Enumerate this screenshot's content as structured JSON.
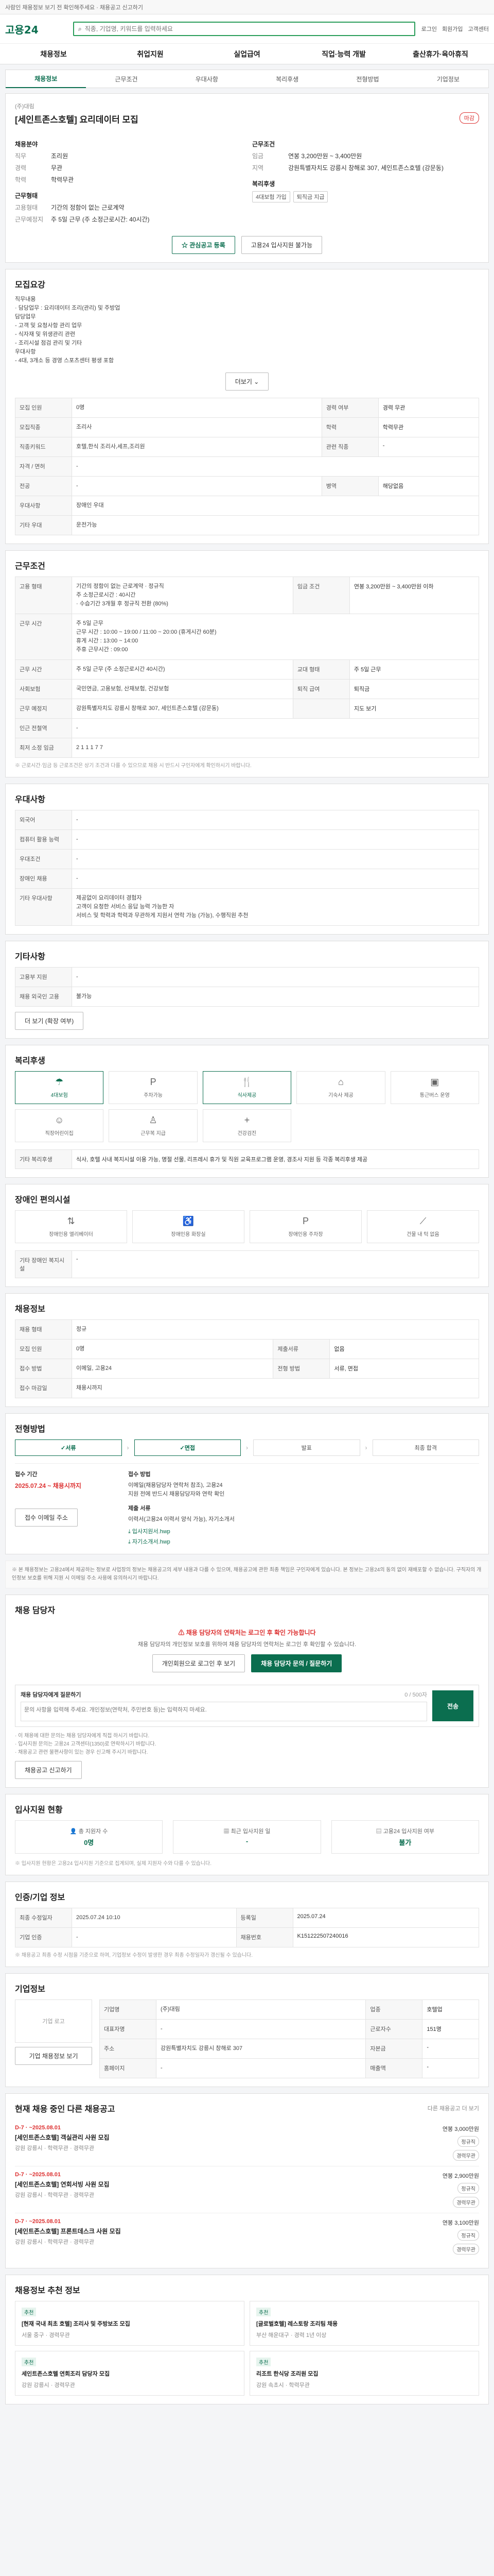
{
  "topbar": {
    "notice": "사람인 채용정보 보기 전 확인해주세요 · 채용공고 신고하기"
  },
  "header": {
    "logo": "고용24",
    "search_placeholder": "직종, 기업명, 키워드를 입력하세요",
    "links": [
      "로그인",
      "회원가입",
      "고객센터"
    ],
    "gnb": [
      "채용정보",
      "취업지원",
      "실업급여",
      "직업·능력 개발",
      "출산휴가·육아휴직"
    ]
  },
  "tabs": [
    "채용정보",
    "근무조건",
    "우대사항",
    "복리후생",
    "전형방법",
    "기업정보"
  ],
  "job": {
    "company": "(주)대림",
    "title": "[세인트존스호텔] 요리데이터 모집",
    "status": "마감",
    "left": {
      "heading": "채용분야",
      "rows": [
        {
          "k": "직무",
          "v": "조리원"
        },
        {
          "k": "경력",
          "v": "무관"
        },
        {
          "k": "학력",
          "v": "학력무관"
        }
      ],
      "cond_heading": "근무형태",
      "cond_rows": [
        {
          "k": "고용형태",
          "v": "기간의 정함이 없는 근로계약"
        },
        {
          "k": "근무예정지",
          "v": "주 5일 근무 (주 소정근로시간: 40시간)"
        }
      ]
    },
    "right": {
      "heading": "근무조건",
      "rows": [
        {
          "k": "임금",
          "v": "연봉 3,200만원 ~ 3,400만원"
        },
        {
          "k": "지역",
          "v": "강원특별자치도 강릉시 창해로 307, 세인트존스호텔 (강문동)"
        }
      ],
      "tag_heading": "복리후생",
      "chips": [
        "4대보험 가입",
        "퇴직금 지급"
      ]
    },
    "btn_interest": "관심공고 등록",
    "btn_apply": "고용24 입사지원 불가능"
  },
  "detail": {
    "heading": "모집요강",
    "body": "직무내용\n· 담당업무 : 요리데이터 조리(관리) 및 주방업\n담당업무\n  - 고객 및 요청사항 관리 업무\n  - 식자재 및 위생관리 관련\n  - 조리시설 점검 관리 및 기타\n우대사항\n  - 4대, 3개소 등 경영 스포츠센터 평생 포함",
    "more": "더보기",
    "table": [
      {
        "k": "모집 인원",
        "v": "0명",
        "k2": "경력 여부",
        "v2": "경력 무관"
      },
      {
        "k": "모집직종",
        "v": "조리사",
        "k2": "학력",
        "v2": "학력무관"
      },
      {
        "k": "직종키워드",
        "v": "호텔,한식 조리사,세프,조리원",
        "k2": "관련 직종",
        "v2": "-"
      },
      {
        "k": "자격 / 면허",
        "v": "-",
        "k2": "",
        "v2": ""
      },
      {
        "k": "전공",
        "v": "-",
        "k2": "병역",
        "v2": "해당없음"
      },
      {
        "k": "우대사항",
        "v": "장애인 우대",
        "k2": "",
        "v2": ""
      },
      {
        "k": "기타 우대",
        "v": "운전가능",
        "k2": "",
        "v2": ""
      }
    ]
  },
  "work": {
    "heading": "근무조건",
    "rows": [
      {
        "k": "고용 형태",
        "v": "기간의 정함이 없는 근로계약 · 정규직\n주 소정근로시간 : 40시간\n· 수습기간 3개월 후 정규직 전환 (80%)",
        "k2": "임금 조건",
        "v2": "연봉 3,200만원 ~ 3,400만원 이하"
      },
      {
        "k": "근무 시간",
        "v": "주 5일 근무\n근무 시간 : 10:00 ~ 19:00 / 11:00 ~ 20:00 (휴게시간 60분)\n휴게 시간 : 13:00 ~ 14:00\n주휴 근무시간 : 09:00",
        "k2": "",
        "v2": ""
      },
      {
        "k": "근무 시간",
        "v": "주 5일 근무 (주 소정근로시간 40시간)",
        "k2": "교대 형태",
        "v2": "주 5일 근무"
      },
      {
        "k": "사회보험",
        "v": "국민연금, 고용보험, 산재보험, 건강보험",
        "k2": "퇴직 급여",
        "v2": "퇴직금"
      },
      {
        "k": "근무 예정지",
        "v": "강원특별자치도 강릉시 창해로 307, 세인트존스호텔 (강문동)",
        "k2": "",
        "v2": "지도 보기"
      },
      {
        "k": "인근 전철역",
        "v": "-",
        "k2": "",
        "v2": ""
      },
      {
        "k": "최저 소정 임금",
        "v": "2 1 1 1 7 7",
        "k2": "",
        "v2": ""
      }
    ],
    "note": "※ 근로시간·임금 등 근로조건은 상기 조건과 다를 수 있으므로 채용 시 반드시 구인자에게 확인하시기 바랍니다."
  },
  "prefer": {
    "heading": "우대사항",
    "rows": [
      {
        "k": "외국어",
        "v": "-"
      },
      {
        "k": "컴퓨터 활용 능력",
        "v": "-"
      },
      {
        "k": "우대조건",
        "v": "-"
      },
      {
        "k": "장애인 채용",
        "v": "-"
      },
      {
        "k": "기타 우대사항",
        "v": "제공없이 요리데이터 경험자\n고객이 요청한 서비스 응답 능력 가능한 자\n서비스 및 학력과 학력과 무관하게 지원서 연락 가능 (가능), 수행직원 추천"
      }
    ]
  },
  "other": {
    "heading": "기타사항",
    "rows": [
      {
        "k": "고용부 지원",
        "v": "-"
      },
      {
        "k": "채용 외국인 고용",
        "v": "불가능"
      }
    ],
    "more_btn": "더 보기 (확장 여부)"
  },
  "welfare": {
    "heading": "복리후생",
    "items": [
      {
        "icon": "insurance-icon",
        "glyph": "☂",
        "label": "4대보험",
        "on": true
      },
      {
        "icon": "parking-icon",
        "glyph": "P",
        "label": "주차가능",
        "on": false
      },
      {
        "icon": "meal-icon",
        "glyph": "🍴",
        "label": "식사제공",
        "on": true
      },
      {
        "icon": "dorm-icon",
        "glyph": "⌂",
        "label": "기숙사 제공",
        "on": false
      },
      {
        "icon": "bus-icon",
        "glyph": "▣",
        "label": "통근버스 운영",
        "on": false
      },
      {
        "icon": "childcare-icon",
        "glyph": "☺",
        "label": "직장어린이집",
        "on": false
      },
      {
        "icon": "uniform-icon",
        "glyph": "♙",
        "label": "근무복 지급",
        "on": false
      },
      {
        "icon": "health-icon",
        "glyph": "+",
        "label": "건강검진",
        "on": false
      }
    ],
    "etc_label": "기타 복리후생",
    "etc_text": "식사, 호텔 사내 복지시설 이용 가능, 명절 선물, 리프레시 휴가 및 직원 교육프로그램 운영, 경조사 지원 등 각종 복리후생 제공"
  },
  "disabled": {
    "heading": "장애인 편의시설",
    "items": [
      "장애인용 엘리베이터",
      "장애인용 화장실",
      "장애인용 주차장",
      "건물 내 턱 없음"
    ],
    "etc_label": "기타 장애인 복지시설",
    "etc_text": "-"
  },
  "process": {
    "heading": "채용정보",
    "rows": [
      {
        "k": "채용 형태",
        "v": "정규"
      },
      {
        "k": "모집 인원",
        "v": "0명",
        "k2": "제출서류",
        "v2": "없음"
      },
      {
        "k": "접수 방법",
        "v": "이메일, 고용24",
        "k2": "전형 방법",
        "v2": "서류, 면접"
      },
      {
        "k": "접수 마감일",
        "v": "채용시까지",
        "k2": "",
        "v2": ""
      }
    ]
  },
  "steps": {
    "heading": "전형방법",
    "list": [
      "서류",
      "면접",
      "발표",
      "최종 합격"
    ],
    "active": [
      true,
      true,
      false,
      false
    ]
  },
  "reception": {
    "period_label": "접수 기간",
    "period": "2025.07.24 ~ 채용시까지",
    "method_label": "접수 방법",
    "method_text": "이메일(채용담당자 연락처 참조), 고용24\n지원 전에 반드시 채용담당자와 연락 확인",
    "submit_label": "제출 서류",
    "submit_text": "이력서(고용24 이력서 양식 가능), 자기소개서",
    "files": [
      "입사지원서.hwp",
      "자기소개서.hwp"
    ],
    "btn": "접수 이메일 주소"
  },
  "disclaimer": "※ 본 채용정보는 고용24에서 제공하는 정보로 사업장의 정보는 채용공고의 세부 내용과 다를 수 있으며, 채용공고에 관한 최종 책임은 구인자에게 있습니다. 본 정보는 고용24의 동의 없이 재배포할 수 없습니다. 구직자의 개인정보 보호를 위해 지원 시 이메일 주소 사용에 유의하시기 바랍니다.",
  "contact": {
    "heading": "채용 담당자",
    "alert": "채용 담당자의 연락처는 로그인 후 확인 가능합니다",
    "alert_sub": "채용 담당자의 개인정보 보호를 위하여 채용 담당자의 연락처는 로그인 후 확인할 수 있습니다.",
    "btn_login": "개인회원으로 로그인 후 보기",
    "btn_send": "채용 담당자 문의 / 질문하기",
    "msg_label": "채용 담당자에게 질문하기",
    "msg_count": "0 / 500자",
    "msg_placeholder": "문의 사항을 입력해 주세요. 개인정보(연락처, 주민번호 등)는 입력하지 마세요.",
    "msg_send": "전송",
    "notes": [
      "· 이 채용에 대한 문의는 채용 담당자에게 직접 하시기 바랍니다.",
      "· 입사지원 문의는 고용24 고객센터(1350)로 연락하시기 바랍니다.",
      "· 채용공고 관련 불편사항이 있는 경우 신고해 주시기 바랍니다."
    ],
    "report_btn": "채용공고 신고하기"
  },
  "stats": {
    "heading": "입사지원 현황",
    "items": [
      {
        "label": "총 지원자 수",
        "value": "0명"
      },
      {
        "label": "최근 입사지원 일",
        "value": "-"
      },
      {
        "label": "고용24 입사지원 여부",
        "value": "불가"
      }
    ],
    "note": "※ 입사지원 현황은 고용24 입사지원 기준으로 집계되며, 실제 지원자 수와 다를 수 있습니다."
  },
  "info": {
    "heading": "인증/기업 정보",
    "rows": [
      {
        "k": "최종 수정일자",
        "v": "2025.07.24 10:10",
        "k2": "등록일",
        "v2": "2025.07.24"
      },
      {
        "k": "기업 인증",
        "v": "-",
        "k2": "채용번호",
        "v2": "K151222507240016"
      }
    ],
    "note": "※ 채용공고 최종 수정 시점을 기준으로 하며, 기업정보 수정이 발생한 경우 최종 수정일자가 갱신될 수 있습니다."
  },
  "company": {
    "heading": "기업정보",
    "logo_text": "기업 로고",
    "btn_hire": "기업 채용정보 보기",
    "rows": [
      {
        "k": "기업명",
        "v": "(주)대림",
        "k2": "업종",
        "v2": "호텔업"
      },
      {
        "k": "대표자명",
        "v": "-",
        "k2": "근로자수",
        "v2": "151명"
      },
      {
        "k": "주소",
        "v": "강원특별자치도 강릉시 창해로 307",
        "k2": "자본금",
        "v2": "-"
      },
      {
        "k": "홈페이지",
        "v": "-",
        "k2": "매출액",
        "v2": "-"
      }
    ]
  },
  "related": {
    "heading": "현재 채용 중인 다른 채용공고",
    "more": "다른 채용공고 더 보기",
    "items": [
      {
        "d": "D-7 · ~2025.08.01",
        "t": "[세인트존스호텔] 객실관리 사원 모집",
        "m": "강원 강릉시 · 학력무관 · 경력무관",
        "salary": "연봉 3,000만원",
        "type": "정규직",
        "badge": "경력무관"
      },
      {
        "d": "D-7 · ~2025.08.01",
        "t": "[세인트존스호텔] 연회서빙 사원 모집",
        "m": "강원 강릉시 · 학력무관 · 경력무관",
        "salary": "연봉 2,900만원",
        "type": "정규직",
        "badge": "경력무관"
      },
      {
        "d": "D-7 · ~2025.08.01",
        "t": "[세인트존스호텔] 프론트데스크 사원 모집",
        "m": "강원 강릉시 · 학력무관 · 경력무관",
        "salary": "연봉 3,100만원",
        "type": "정규직",
        "badge": "경력무관"
      }
    ]
  },
  "reco": {
    "heading": "채용정보 추천 정보",
    "items": [
      {
        "badge": "추천",
        "t": "[현재 국내 최초 호텔] 조리사 및 주방보조 모집",
        "m": "서울 중구 · 경력무관"
      },
      {
        "badge": "추천",
        "t": "[글로벌호텔] 레스토랑 조리팀 채용",
        "m": "부산 해운대구 · 경력 1년 이상"
      },
      {
        "badge": "추천",
        "t": "세인트존스호텔 연회조리 담당자 모집",
        "m": "강원 강릉시 · 경력무관"
      },
      {
        "badge": "추천",
        "t": "리조트 한식당 조리원 모집",
        "m": "강원 속초시 · 학력무관"
      }
    ]
  }
}
